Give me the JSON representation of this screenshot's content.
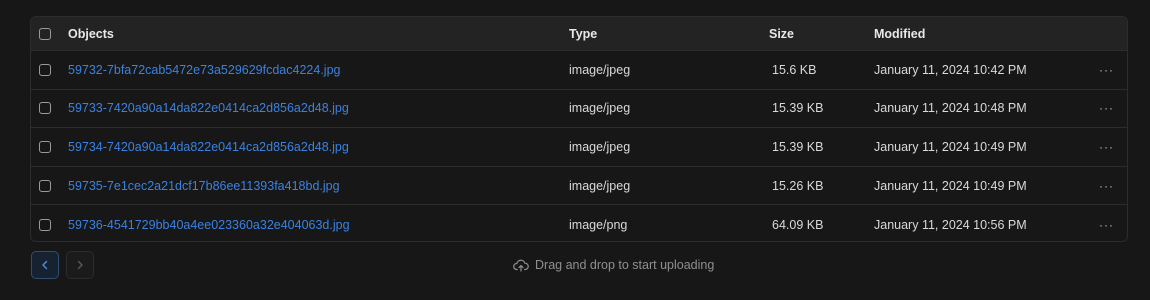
{
  "table": {
    "columns": {
      "objects": "Objects",
      "type": "Type",
      "size": "Size",
      "modified": "Modified"
    },
    "rows": [
      {
        "name": "59732-7bfa72cab5472e73a529629fcdac4224.jpg",
        "type": "image/jpeg",
        "size": "15.6 KB",
        "modified": "January 11, 2024 10:42 PM",
        "menu": "···"
      },
      {
        "name": "59733-7420a90a14da822e0414ca2d856a2d48.jpg",
        "type": "image/jpeg",
        "size": "15.39 KB",
        "modified": "January 11, 2024 10:48 PM",
        "menu": "···"
      },
      {
        "name": "59734-7420a90a14da822e0414ca2d856a2d48.jpg",
        "type": "image/jpeg",
        "size": "15.39 KB",
        "modified": "January 11, 2024 10:49 PM",
        "menu": "···"
      },
      {
        "name": "59735-7e1cec2a21dcf17b86ee11393fa418bd.jpg",
        "type": "image/jpeg",
        "size": "15.26 KB",
        "modified": "January 11, 2024 10:49 PM",
        "menu": "···"
      },
      {
        "name": "59736-4541729bb40a4ee023360a32e404063d.jpg",
        "type": "image/png",
        "size": "64.09 KB",
        "modified": "January 11, 2024 10:56 PM",
        "menu": "···"
      }
    ]
  },
  "pagination": {
    "prev_icon": "chevron-left-icon",
    "next_icon": "chevron-right-icon"
  },
  "upload": {
    "icon": "cloud-upload-icon",
    "text": "Drag and drop to start uploading"
  },
  "colors": {
    "background": "#171717",
    "header_bg": "#232323",
    "link": "#3b82e0",
    "border": "#2c2c2c"
  }
}
